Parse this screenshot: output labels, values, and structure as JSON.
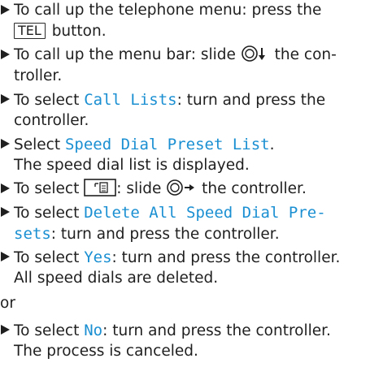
{
  "steps": [
    {
      "a": "To call up the telephone menu: press the",
      "key": "TEL",
      "b": "button."
    },
    {
      "a": "To call up the menu bar: slide",
      "b": "the con-",
      "c": "troller."
    },
    {
      "a": "To select",
      "menu": "Call Lists",
      "b": ": turn and press the",
      "c": "controller."
    },
    {
      "a": "Select",
      "menu": "Speed Dial Preset List",
      "b": ".",
      "c": "The speed dial list is displayed."
    },
    {
      "a": "To select",
      "b": ": slide",
      "c": "the controller."
    },
    {
      "a": "To select",
      "menu1": "Delete All Speed Dial Pre-",
      "menu2": "sets",
      "b": ": turn and press the controller."
    },
    {
      "a": "To select",
      "menu": "Yes",
      "b": ": turn and press the controller.",
      "c": "All speed dials are deleted."
    },
    {
      "a": "To select",
      "menu": "No",
      "b": ": turn and press the controller.",
      "c": "The process is canceled."
    }
  ],
  "or_label": "or",
  "icons": [
    "triangle-bullet-icon",
    "controller-slide-down-icon",
    "controller-slide-right-icon",
    "menu-options-icon"
  ]
}
